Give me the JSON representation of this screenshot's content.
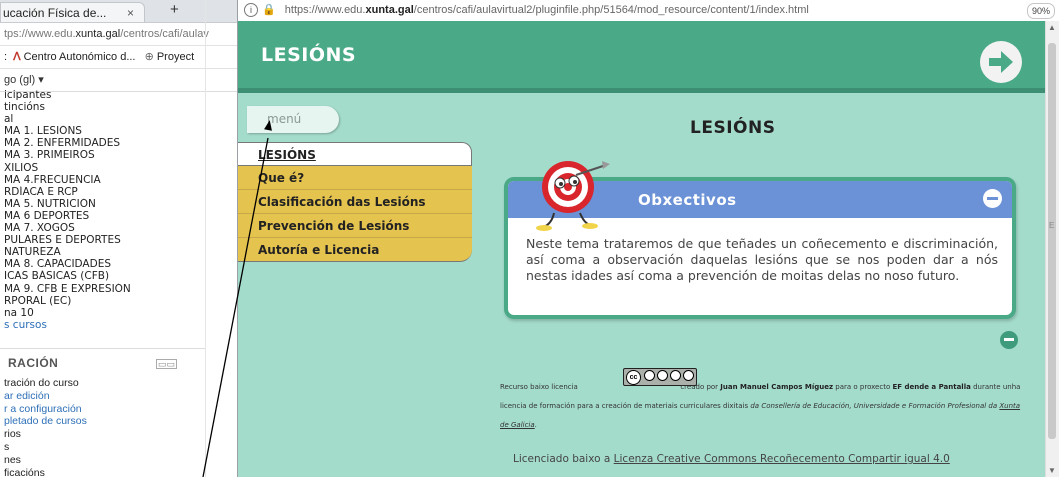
{
  "left_browser": {
    "tab_title": "ucación Física de...",
    "tab_close": "×",
    "new_tab": "+",
    "url": "tps://www.edu.",
    "url_domain": "xunta.gal",
    "url_rest": "/centros/cafi/aulav",
    "bookmark_prefix": ":",
    "bookmark_label": "Centro Autonómico d...",
    "bookmark2": "Proyect",
    "language": "go (gl) ▾"
  },
  "left_nav": [
    {
      "text": "icipantes",
      "link": false
    },
    {
      "text": "tincións",
      "link": false
    },
    {
      "text": "al",
      "link": false
    },
    {
      "text": "MA 1. LESIÓNS",
      "link": false
    },
    {
      "text": "MA 2. ENFERMIDADES",
      "link": false
    },
    {
      "text": "MA 3. PRIMEIROS",
      "link": false
    },
    {
      "text": "XILIOS",
      "link": false
    },
    {
      "text": "MA 4.FRECUENCIA",
      "link": false
    },
    {
      "text": "RDÍACA E RCP",
      "link": false
    },
    {
      "text": "MA 5. NUTRICIÓN",
      "link": false
    },
    {
      "text": "MA 6 DEPORTES",
      "link": false
    },
    {
      "text": "MA 7. XOGOS",
      "link": false
    },
    {
      "text": "PULARES E DEPORTES",
      "link": false
    },
    {
      "text": "NATUREZA",
      "link": false
    },
    {
      "text": "MA 8. CAPACIDADES",
      "link": false
    },
    {
      "text": "ICAS BÁSICAS (CFB)",
      "link": false
    },
    {
      "text": "MA 9. CFB E EXPRESIÓN",
      "link": false
    },
    {
      "text": "RPORAL (EC)",
      "link": false
    },
    {
      "text": "na 10",
      "link": false
    },
    {
      "text": "s cursos",
      "link": true
    }
  ],
  "admin": {
    "heading": "RACIÓN",
    "items": [
      {
        "text": "tración do curso",
        "link": false
      },
      {
        "text": "ar edición",
        "link": true
      },
      {
        "text": "r a configuración",
        "link": true
      },
      {
        "text": "pletado de cursos",
        "link": true
      },
      {
        "text": "rios",
        "link": false
      },
      {
        "text": "s",
        "link": false
      },
      {
        "text": "nes",
        "link": false
      },
      {
        "text": "ficacións",
        "link": false
      }
    ]
  },
  "main_browser": {
    "info": "i",
    "url_prefix": "https://www.edu.",
    "url_domain": "xunta.gal",
    "url_rest": "/centros/cafi/aulavirtual2/pluginfile.php/51564/mod_resource/content/1/index.html",
    "zoom": "90%"
  },
  "page": {
    "header_title": "LESIÓNS",
    "menu_button": "menú",
    "title": "LESIÓNS",
    "menu_items": [
      "LESIÓNS",
      "Que é?",
      "Clasificación das Lesións",
      "Prevención de Lesións",
      "Autoría e Licencia"
    ],
    "objectives_title": "Obxectivos",
    "objectives_text": "Neste tema trataremos de que teñades un coñecemento e discriminación, así coma a observación daquelas lesións que se nos poden dar a nós nestas idades así coma a prevención de moitas delas no noso futuro.",
    "license": {
      "recurso": "Recurso baixo licencia",
      "created_by": "creado por",
      "author": "Juan Manuel Campos Míguez",
      "para": "para o proxecto",
      "project": "EF dende a Pantalla",
      "rest1": "durante unha licencia de formación para a creación de materiais curriculares dixitais",
      "ministry": "da Consellería de Educación, Universidade e Formación Profesional",
      "da": "da",
      "xunta": "Xunta de Galicia",
      "dot": "."
    },
    "licensed_prefix": "Licenciado baixo a",
    "licensed_link": "Licenza Creative Commons Recoñecemento Compartir igual 4.0"
  },
  "colors": {
    "page_bg": "#a4dccc",
    "header": "#4aaa88",
    "menu_yellow": "#e5c34f",
    "objectives_blue": "#6b91d6"
  }
}
